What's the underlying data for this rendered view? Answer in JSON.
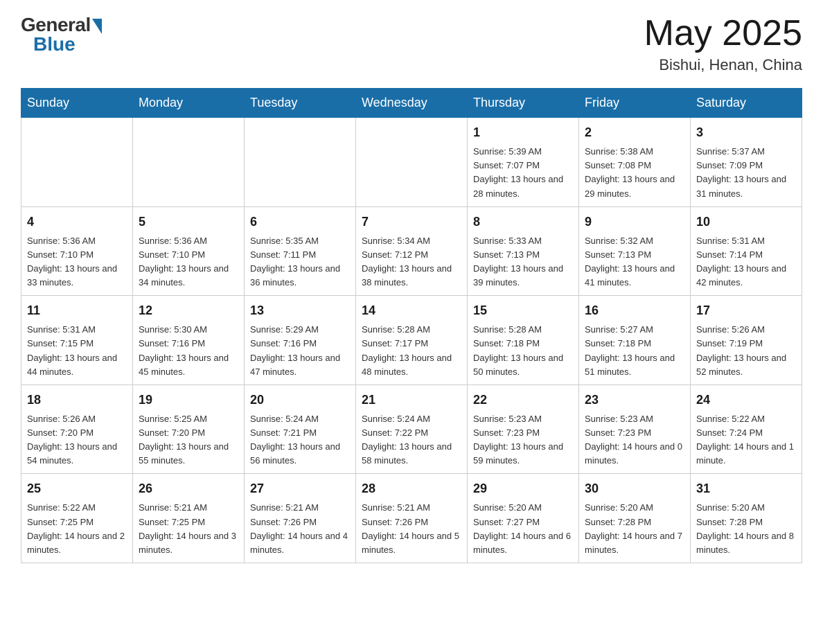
{
  "header": {
    "logo_general": "General",
    "logo_blue": "Blue",
    "month_year": "May 2025",
    "location": "Bishui, Henan, China"
  },
  "weekdays": [
    "Sunday",
    "Monday",
    "Tuesday",
    "Wednesday",
    "Thursday",
    "Friday",
    "Saturday"
  ],
  "weeks": [
    [
      {
        "day": "",
        "info": ""
      },
      {
        "day": "",
        "info": ""
      },
      {
        "day": "",
        "info": ""
      },
      {
        "day": "",
        "info": ""
      },
      {
        "day": "1",
        "info": "Sunrise: 5:39 AM\nSunset: 7:07 PM\nDaylight: 13 hours\nand 28 minutes."
      },
      {
        "day": "2",
        "info": "Sunrise: 5:38 AM\nSunset: 7:08 PM\nDaylight: 13 hours\nand 29 minutes."
      },
      {
        "day": "3",
        "info": "Sunrise: 5:37 AM\nSunset: 7:09 PM\nDaylight: 13 hours\nand 31 minutes."
      }
    ],
    [
      {
        "day": "4",
        "info": "Sunrise: 5:36 AM\nSunset: 7:10 PM\nDaylight: 13 hours\nand 33 minutes."
      },
      {
        "day": "5",
        "info": "Sunrise: 5:36 AM\nSunset: 7:10 PM\nDaylight: 13 hours\nand 34 minutes."
      },
      {
        "day": "6",
        "info": "Sunrise: 5:35 AM\nSunset: 7:11 PM\nDaylight: 13 hours\nand 36 minutes."
      },
      {
        "day": "7",
        "info": "Sunrise: 5:34 AM\nSunset: 7:12 PM\nDaylight: 13 hours\nand 38 minutes."
      },
      {
        "day": "8",
        "info": "Sunrise: 5:33 AM\nSunset: 7:13 PM\nDaylight: 13 hours\nand 39 minutes."
      },
      {
        "day": "9",
        "info": "Sunrise: 5:32 AM\nSunset: 7:13 PM\nDaylight: 13 hours\nand 41 minutes."
      },
      {
        "day": "10",
        "info": "Sunrise: 5:31 AM\nSunset: 7:14 PM\nDaylight: 13 hours\nand 42 minutes."
      }
    ],
    [
      {
        "day": "11",
        "info": "Sunrise: 5:31 AM\nSunset: 7:15 PM\nDaylight: 13 hours\nand 44 minutes."
      },
      {
        "day": "12",
        "info": "Sunrise: 5:30 AM\nSunset: 7:16 PM\nDaylight: 13 hours\nand 45 minutes."
      },
      {
        "day": "13",
        "info": "Sunrise: 5:29 AM\nSunset: 7:16 PM\nDaylight: 13 hours\nand 47 minutes."
      },
      {
        "day": "14",
        "info": "Sunrise: 5:28 AM\nSunset: 7:17 PM\nDaylight: 13 hours\nand 48 minutes."
      },
      {
        "day": "15",
        "info": "Sunrise: 5:28 AM\nSunset: 7:18 PM\nDaylight: 13 hours\nand 50 minutes."
      },
      {
        "day": "16",
        "info": "Sunrise: 5:27 AM\nSunset: 7:18 PM\nDaylight: 13 hours\nand 51 minutes."
      },
      {
        "day": "17",
        "info": "Sunrise: 5:26 AM\nSunset: 7:19 PM\nDaylight: 13 hours\nand 52 minutes."
      }
    ],
    [
      {
        "day": "18",
        "info": "Sunrise: 5:26 AM\nSunset: 7:20 PM\nDaylight: 13 hours\nand 54 minutes."
      },
      {
        "day": "19",
        "info": "Sunrise: 5:25 AM\nSunset: 7:20 PM\nDaylight: 13 hours\nand 55 minutes."
      },
      {
        "day": "20",
        "info": "Sunrise: 5:24 AM\nSunset: 7:21 PM\nDaylight: 13 hours\nand 56 minutes."
      },
      {
        "day": "21",
        "info": "Sunrise: 5:24 AM\nSunset: 7:22 PM\nDaylight: 13 hours\nand 58 minutes."
      },
      {
        "day": "22",
        "info": "Sunrise: 5:23 AM\nSunset: 7:23 PM\nDaylight: 13 hours\nand 59 minutes."
      },
      {
        "day": "23",
        "info": "Sunrise: 5:23 AM\nSunset: 7:23 PM\nDaylight: 14 hours\nand 0 minutes."
      },
      {
        "day": "24",
        "info": "Sunrise: 5:22 AM\nSunset: 7:24 PM\nDaylight: 14 hours\nand 1 minute."
      }
    ],
    [
      {
        "day": "25",
        "info": "Sunrise: 5:22 AM\nSunset: 7:25 PM\nDaylight: 14 hours\nand 2 minutes."
      },
      {
        "day": "26",
        "info": "Sunrise: 5:21 AM\nSunset: 7:25 PM\nDaylight: 14 hours\nand 3 minutes."
      },
      {
        "day": "27",
        "info": "Sunrise: 5:21 AM\nSunset: 7:26 PM\nDaylight: 14 hours\nand 4 minutes."
      },
      {
        "day": "28",
        "info": "Sunrise: 5:21 AM\nSunset: 7:26 PM\nDaylight: 14 hours\nand 5 minutes."
      },
      {
        "day": "29",
        "info": "Sunrise: 5:20 AM\nSunset: 7:27 PM\nDaylight: 14 hours\nand 6 minutes."
      },
      {
        "day": "30",
        "info": "Sunrise: 5:20 AM\nSunset: 7:28 PM\nDaylight: 14 hours\nand 7 minutes."
      },
      {
        "day": "31",
        "info": "Sunrise: 5:20 AM\nSunset: 7:28 PM\nDaylight: 14 hours\nand 8 minutes."
      }
    ]
  ]
}
